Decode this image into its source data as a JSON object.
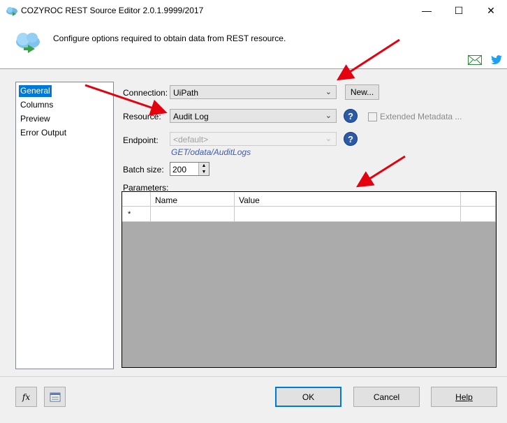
{
  "window": {
    "title": "COZYROC REST Source Editor 2.0.1.9999/2017",
    "minimize": "—",
    "maximize": "☐",
    "close": "✕"
  },
  "header": {
    "description": "Configure options required to obtain data from REST resource."
  },
  "nav": {
    "items": [
      {
        "label": "General",
        "selected": true
      },
      {
        "label": "Columns"
      },
      {
        "label": "Preview"
      },
      {
        "label": "Error Output"
      }
    ]
  },
  "form": {
    "connection_label": "Connection:",
    "connection_value": "UiPath",
    "new_button": "New...",
    "resource_label": "Resource:",
    "resource_value": "Audit Log",
    "extended_metadata_label": "Extended Metadata ...",
    "endpoint_label": "Endpoint:",
    "endpoint_value": "<default>",
    "endpoint_method": "GET",
    "endpoint_path": "/odata/AuditLogs",
    "batch_size_label": "Batch size:",
    "batch_size_value": "200",
    "parameters_label": "Parameters:"
  },
  "parameters_grid": {
    "columns": [
      "Name",
      "Value"
    ],
    "new_row_marker": "*"
  },
  "footer": {
    "fx_button": "fx",
    "ok_button": "OK",
    "cancel_button": "Cancel",
    "help_button": "Help"
  },
  "colors": {
    "accent": "#0078d7",
    "annotation_arrow": "#e3000f",
    "link": "#3b5cb5"
  }
}
